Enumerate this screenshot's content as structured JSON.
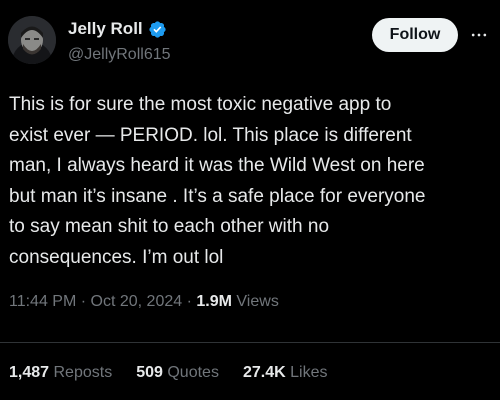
{
  "author": {
    "display_name": "Jelly Roll",
    "handle": "@JellyRoll615",
    "verified_icon": "verified-badge-icon",
    "avatar_icon": "profile-avatar"
  },
  "actions": {
    "follow_label": "Follow",
    "more_icon": "more-options-icon"
  },
  "tweet": {
    "text": "This is for sure the most toxic negative app to\nexist ever — PERIOD. lol. This place is different\nman, I always heard it was the Wild West on here\nbut man it’s insane . It’s a safe place for everyone\nto say mean shit to each other with no\nconsequences. I’m out lol",
    "time": "11:44 PM",
    "separator": "·",
    "date": "Oct 20, 2024",
    "views_count": "1.9M",
    "views_label": "Views"
  },
  "stats": {
    "reposts_count": "1,487",
    "reposts_label": "Reposts",
    "quotes_count": "509",
    "quotes_label": "Quotes",
    "likes_count": "27.4K",
    "likes_label": "Likes"
  },
  "colors": {
    "background": "#000000",
    "text_primary": "#e7e9ea",
    "text_secondary": "#71767b",
    "verified_blue": "#1d9bf0",
    "follow_bg": "#eff3f4",
    "divider": "#2f3336"
  }
}
